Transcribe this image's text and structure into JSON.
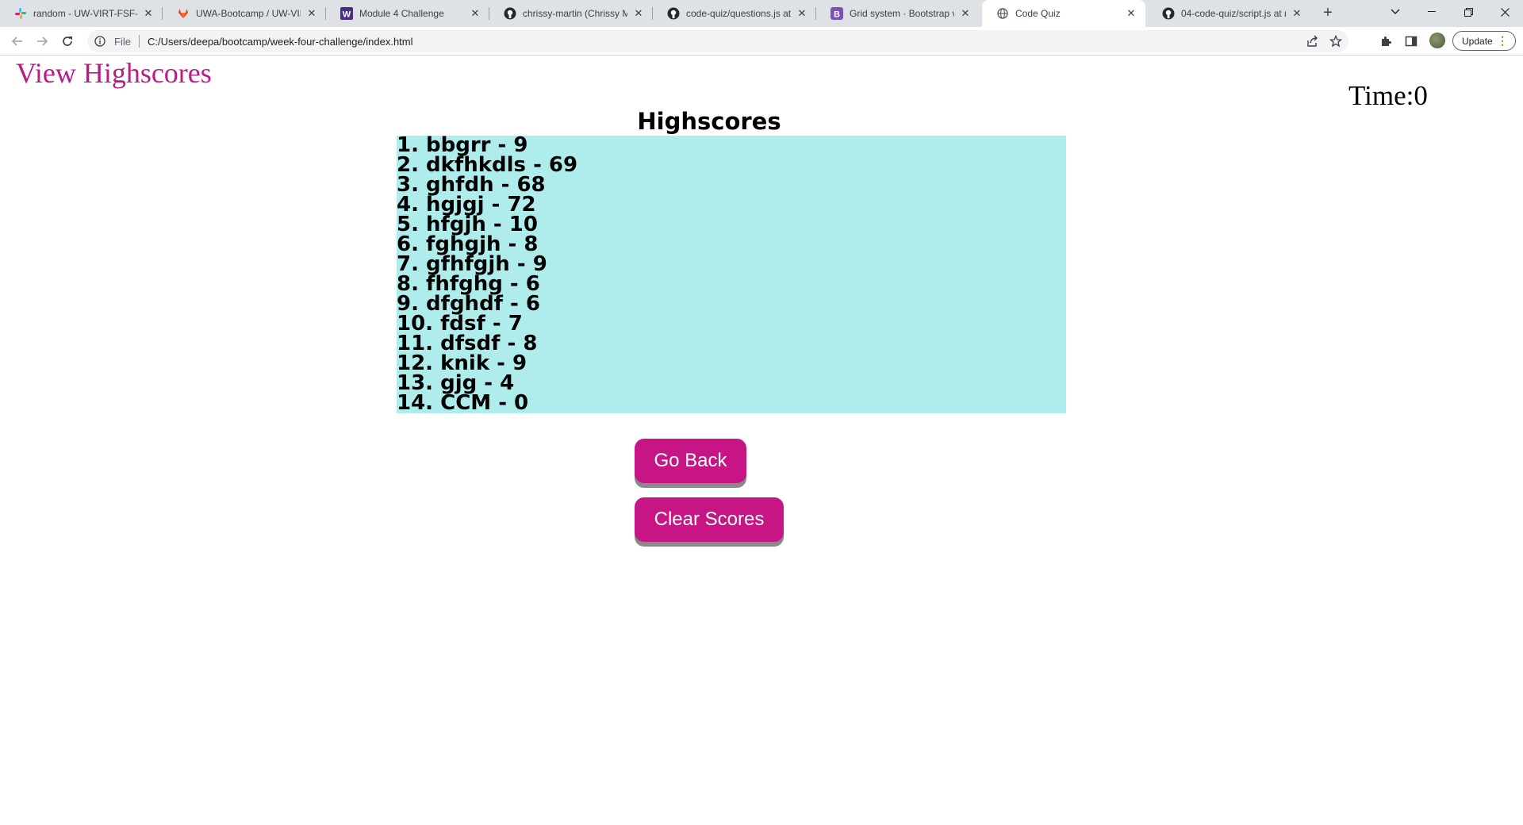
{
  "browser": {
    "tabs": [
      {
        "title": "random - UW-VIRT-FSF-PT",
        "icon": "slack-icon"
      },
      {
        "title": "UWA-Bootcamp / UW-VIRT",
        "icon": "gitlab-icon"
      },
      {
        "title": "Module 4 Challenge",
        "icon": "w-icon"
      },
      {
        "title": "chrissy-martin (Chrissy Ma",
        "icon": "github-icon"
      },
      {
        "title": "code-quiz/questions.js at r",
        "icon": "github-icon"
      },
      {
        "title": "Grid system · Bootstrap v5.",
        "icon": "bootstrap-icon"
      },
      {
        "title": "Code Quiz",
        "icon": "globe-icon"
      },
      {
        "title": "04-code-quiz/script.js at m",
        "icon": "github-icon"
      }
    ],
    "address": {
      "scheme": "File",
      "url": "C:/Users/deepa/bootcamp/week-four-challenge/index.html"
    },
    "update_label": "Update"
  },
  "page": {
    "view_highscores": "View Highscores",
    "timer": "Time:0",
    "highscores_title": "Highscores",
    "scores": [
      "1. bbgrr - 9",
      "2. dkfhkdls - 69",
      "3. ghfdh - 68",
      "4. hgjgj - 72",
      "5. hfgjh - 10",
      "6. fghgjh - 8",
      "7. gfhfgjh - 9",
      "8. fhfghg - 6",
      "9. dfghdf - 6",
      "10. fdsf - 7",
      "11. dfsdf - 8",
      "12. knik - 9",
      "13. gjg - 4",
      "14. CCM - 0"
    ],
    "go_back_label": "Go Back",
    "clear_scores_label": "Clear Scores"
  },
  "colors": {
    "accent": "#c71585",
    "link": "#b81c85",
    "list_bg": "#afeded"
  }
}
